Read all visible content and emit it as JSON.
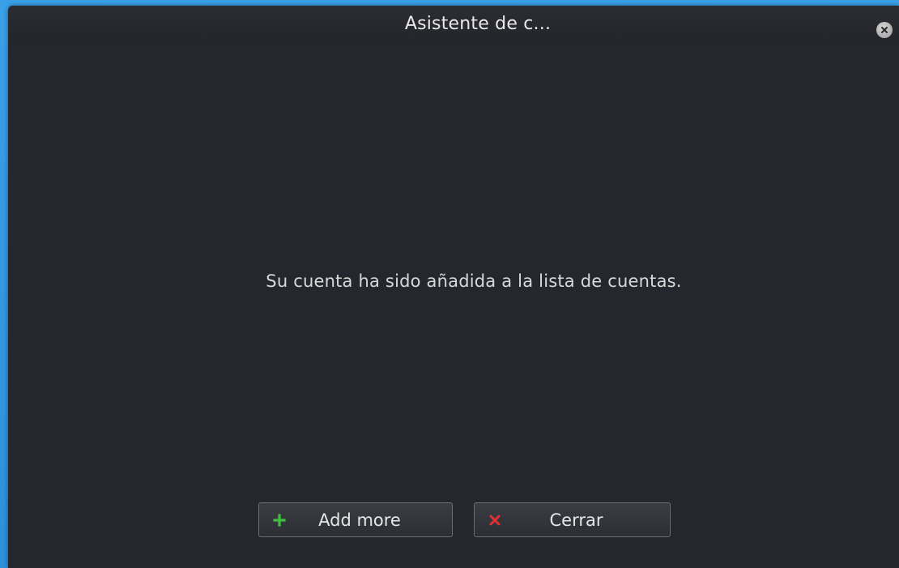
{
  "window": {
    "title": "Asistente de c...",
    "message": "Su cuenta ha sido añadida a la lista de cuentas."
  },
  "buttons": {
    "add_more_label": "Add more",
    "close_label": "Cerrar"
  },
  "icons": {
    "title_close": "close-circle-icon",
    "add": "plus-icon",
    "cancel": "x-icon"
  },
  "colors": {
    "desktop_background": "#3aa0e8",
    "window_background": "#25272e",
    "plus_icon": "#3fbf3f",
    "x_icon": "#e03030"
  }
}
